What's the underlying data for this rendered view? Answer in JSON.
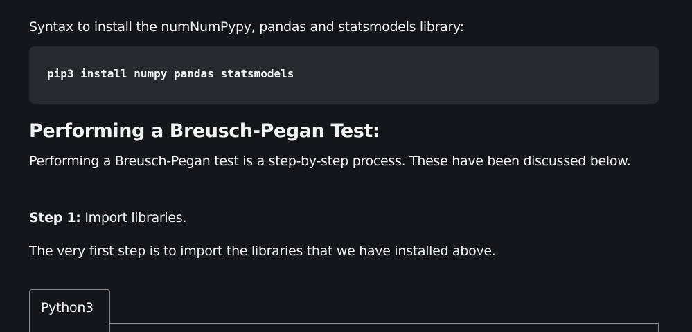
{
  "intro_text": "Syntax to install the numNumPypy, pandas and statsmodels library:",
  "code": "pip3 install numpy pandas statsmodels",
  "heading": "Performing a Breusch-Pegan Test:",
  "paragraph": "Performing a Breusch-Pegan test is a step-by-step process. These have been discussed below.",
  "step": {
    "label": "Step 1:",
    "text": " Import libraries."
  },
  "paragraph2": "The very first step is to import the libraries that we have installed above.",
  "tabs": [
    {
      "label": "Python3"
    }
  ]
}
